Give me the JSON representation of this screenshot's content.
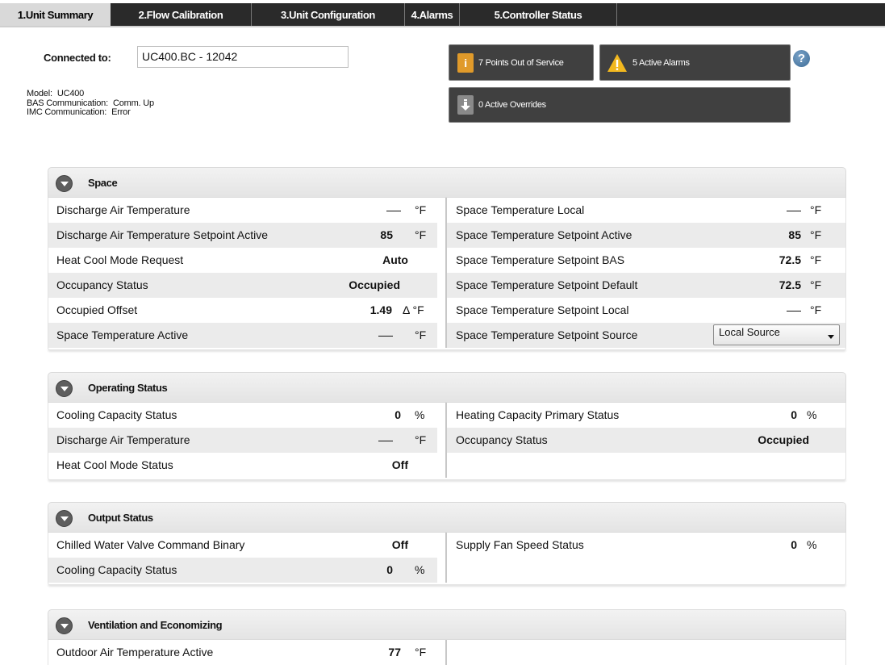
{
  "tabs": [
    {
      "label": "1.Unit Summary"
    },
    {
      "label": "2.Flow Calibration"
    },
    {
      "label": "3.Unit Configuration"
    },
    {
      "label": "4.Alarms"
    },
    {
      "label": "5.Controller Status"
    }
  ],
  "connection": {
    "label": "Connected to:",
    "value": "UC400.BC - 12042",
    "model_label": "Model:",
    "model_value": "UC400",
    "bas_label": "BAS Communication:",
    "bas_value": "Comm. Up",
    "imc_label": "IMC Communication:",
    "imc_value": "Error"
  },
  "status_buttons": {
    "out_of_service": "7 Points Out of Service",
    "active_alarms": "5 Active Alarms",
    "active_overrides": "0 Active Overrides"
  },
  "icons": {
    "info": "info-icon",
    "warning": "warning-icon",
    "override": "override-down-icon",
    "help": "help-icon",
    "collapse": "chevron-down-icon"
  },
  "colors": {
    "tab_bar": "#2a2a2a",
    "active_tab": "#d9d9d9",
    "status_button": "#404040",
    "info_icon": "#e09a2a",
    "warning_icon": "#f2b81f",
    "help_icon": "#4a7aa6"
  },
  "sections": {
    "space": {
      "title": "Space",
      "left": [
        {
          "label": "Discharge Air Temperature",
          "value": "",
          "unit": "°F",
          "dash": true
        },
        {
          "label": "Discharge Air Temperature Setpoint Active",
          "value": "85",
          "unit": "°F"
        },
        {
          "label": "Heat Cool Mode Request",
          "value": "Auto",
          "unit": ""
        },
        {
          "label": "Occupancy Status",
          "value": "Occupied",
          "unit": ""
        },
        {
          "label": "Occupied Offset",
          "value": "1.49",
          "unit": "Δ °F"
        },
        {
          "label": "Space Temperature Active",
          "value": "",
          "unit": "°F",
          "dash": true
        }
      ],
      "right": [
        {
          "label": "Space Temperature Local",
          "value": "",
          "unit": "°F",
          "dash": true
        },
        {
          "label": "Space Temperature Setpoint Active",
          "value": "85",
          "unit": "°F"
        },
        {
          "label": "Space Temperature Setpoint BAS",
          "value": "72.5",
          "unit": "°F"
        },
        {
          "label": "Space Temperature Setpoint Default",
          "value": "72.5",
          "unit": "°F"
        },
        {
          "label": "Space Temperature Setpoint Local",
          "value": "",
          "unit": "°F",
          "dash": true
        },
        {
          "label": "Space Temperature Setpoint Source",
          "select": "Local Source"
        }
      ]
    },
    "operating": {
      "title": "Operating Status",
      "left": [
        {
          "label": "Cooling Capacity Status",
          "value": "0",
          "unit": "%"
        },
        {
          "label": "Discharge Air Temperature",
          "value": "",
          "unit": "°F",
          "dash": true
        },
        {
          "label": "Heat Cool Mode Status",
          "value": "Off",
          "unit": ""
        }
      ],
      "right": [
        {
          "label": "Heating Capacity Primary Status",
          "value": "0",
          "unit": "%"
        },
        {
          "label": "Occupancy Status",
          "value": "Occupied",
          "unit": ""
        }
      ]
    },
    "output": {
      "title": "Output Status",
      "left": [
        {
          "label": "Chilled Water Valve Command Binary",
          "value": "Off",
          "unit": ""
        },
        {
          "label": "Cooling Capacity Status",
          "value": "0",
          "unit": "%"
        }
      ],
      "right": [
        {
          "label": "Supply Fan Speed Status",
          "value": "0",
          "unit": "%"
        }
      ]
    },
    "ventilation": {
      "title": "Ventilation and Economizing",
      "left": [
        {
          "label": "Outdoor Air Temperature Active",
          "value": "77",
          "unit": "°F"
        }
      ],
      "right": []
    }
  }
}
